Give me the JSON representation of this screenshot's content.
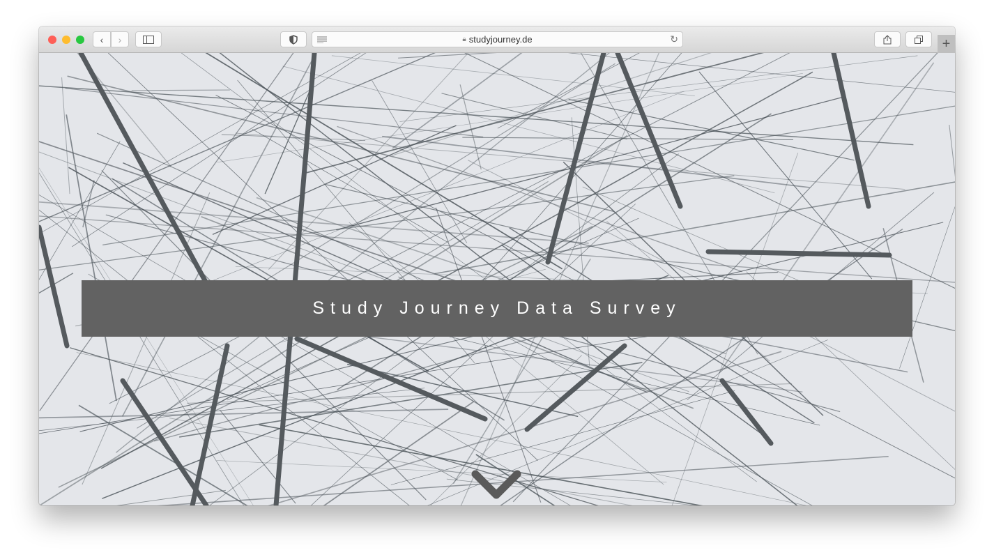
{
  "browser": {
    "url": "studyjourney.de",
    "icons": [
      "close-dot",
      "minimize-dot",
      "zoom-dot",
      "back-icon",
      "forward-icon",
      "sidebar-icon",
      "shield-icon",
      "reader-icon",
      "lock-icon",
      "reload-icon",
      "share-icon",
      "tabs-icon",
      "new-tab-icon"
    ]
  },
  "page": {
    "title": "Study Journey Data Survey",
    "banner_color": "#626262",
    "scroll_icon": "chevron-down-icon"
  }
}
